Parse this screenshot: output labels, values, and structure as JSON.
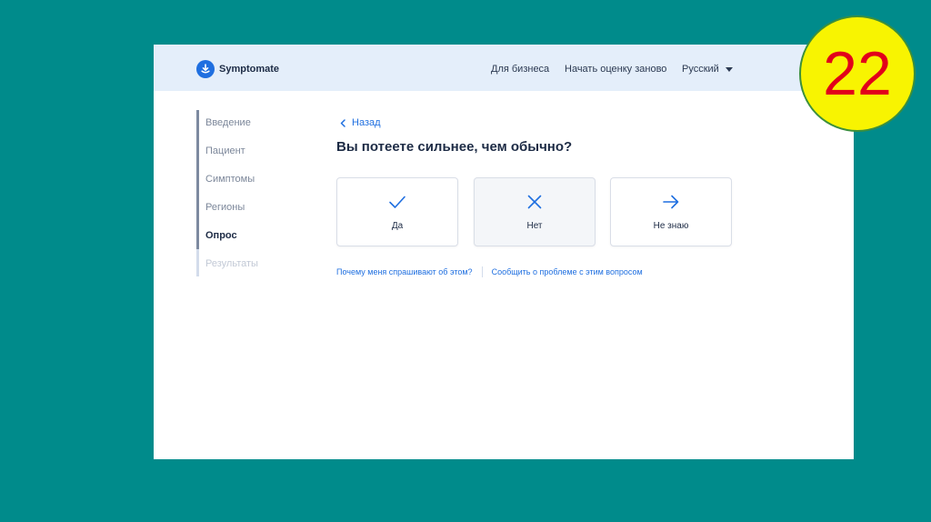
{
  "header": {
    "logo_text": "Symptomate",
    "nav": {
      "business": "Для бизнеса",
      "restart": "Начать оценку заново",
      "language": "Русский"
    }
  },
  "sidebar": {
    "items": [
      {
        "label": "Введение",
        "state": "done"
      },
      {
        "label": "Пациент",
        "state": "done"
      },
      {
        "label": "Симптомы",
        "state": "done"
      },
      {
        "label": "Регионы",
        "state": "done"
      },
      {
        "label": "Опрос",
        "state": "active"
      },
      {
        "label": "Результаты",
        "state": "disabled"
      }
    ]
  },
  "main": {
    "back_label": "Назад",
    "question": "Вы потеете сильнее, чем обычно?",
    "answers": [
      {
        "label": "Да",
        "icon": "check-icon"
      },
      {
        "label": "Нет",
        "icon": "x-icon"
      },
      {
        "label": "Не знаю",
        "icon": "arrow-right-icon"
      }
    ],
    "links": {
      "why": "Почему меня спрашивают об этом?",
      "report": "Сообщить о проблеме с этим вопросом"
    }
  },
  "slide_badge": {
    "number": "22"
  },
  "colors": {
    "background": "#008b8b",
    "accent": "#1f6fe0",
    "header_bg": "#e4eefa",
    "badge_fill": "#f8f401",
    "badge_text": "#e2001a"
  }
}
